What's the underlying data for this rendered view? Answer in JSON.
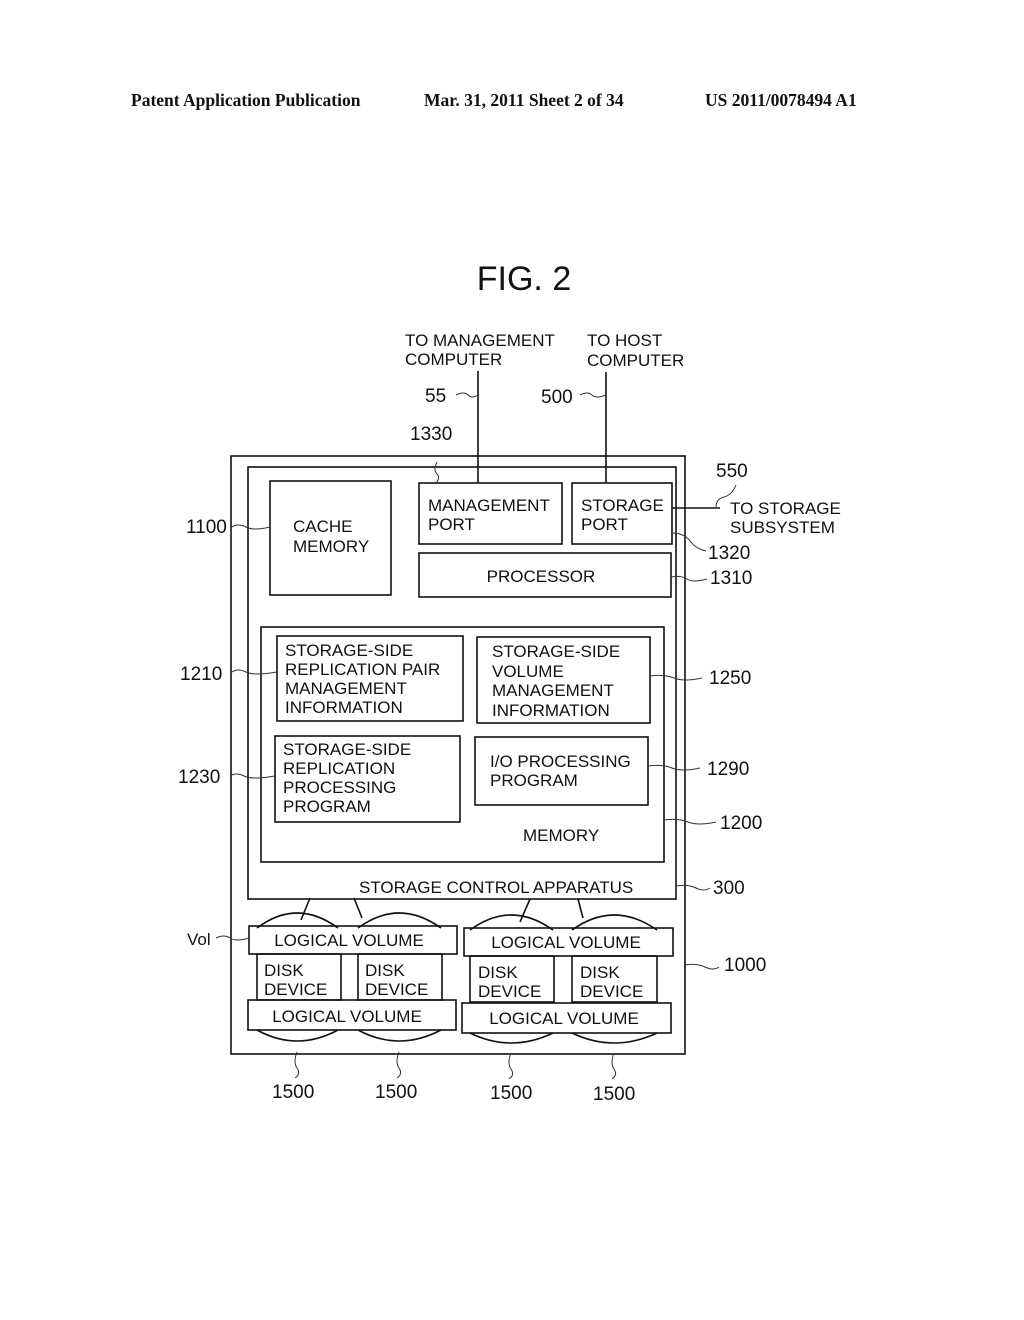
{
  "header": {
    "publication": "Patent Application Publication",
    "date_sheet": "Mar. 31, 2011  Sheet 2 of 34",
    "pub_number": "US 2011/0078494 A1"
  },
  "figure": {
    "title": "FIG. 2",
    "external": {
      "to_management_computer": [
        "TO MANAGEMENT",
        "COMPUTER"
      ],
      "to_host_computer": [
        "TO HOST",
        "COMPUTER"
      ],
      "to_storage_subsystem": [
        "TO STORAGE",
        "SUBSYSTEM"
      ]
    },
    "blocks": {
      "cache_memory": [
        "CACHE",
        "MEMORY"
      ],
      "management_port": [
        "MANAGEMENT",
        "PORT"
      ],
      "storage_port": [
        "STORAGE",
        "PORT"
      ],
      "processor": "PROCESSOR",
      "replication_pair_info": [
        "STORAGE-SIDE",
        "REPLICATION PAIR",
        "MANAGEMENT",
        "INFORMATION"
      ],
      "volume_mgmt_info": [
        "STORAGE-SIDE",
        "VOLUME",
        "MANAGEMENT",
        "INFORMATION"
      ],
      "replication_program": [
        "STORAGE-SIDE",
        "REPLICATION",
        "PROCESSING",
        "PROGRAM"
      ],
      "io_program": [
        "I/O PROCESSING",
        "PROGRAM"
      ],
      "memory": "MEMORY",
      "storage_control_apparatus": "STORAGE CONTROL APPARATUS",
      "logical_volume": "LOGICAL VOLUME",
      "disk_device": [
        "DISK",
        "DEVICE"
      ]
    },
    "refs": {
      "r55": "55",
      "r500": "500",
      "r1330": "1330",
      "r550": "550",
      "r1100": "1100",
      "r1320": "1320",
      "r1310": "1310",
      "r1210": "1210",
      "r1250": "1250",
      "r1230": "1230",
      "r1290": "1290",
      "r1200": "1200",
      "r300": "300",
      "vol": "Vol",
      "r1000": "1000",
      "r1500": "1500"
    }
  }
}
